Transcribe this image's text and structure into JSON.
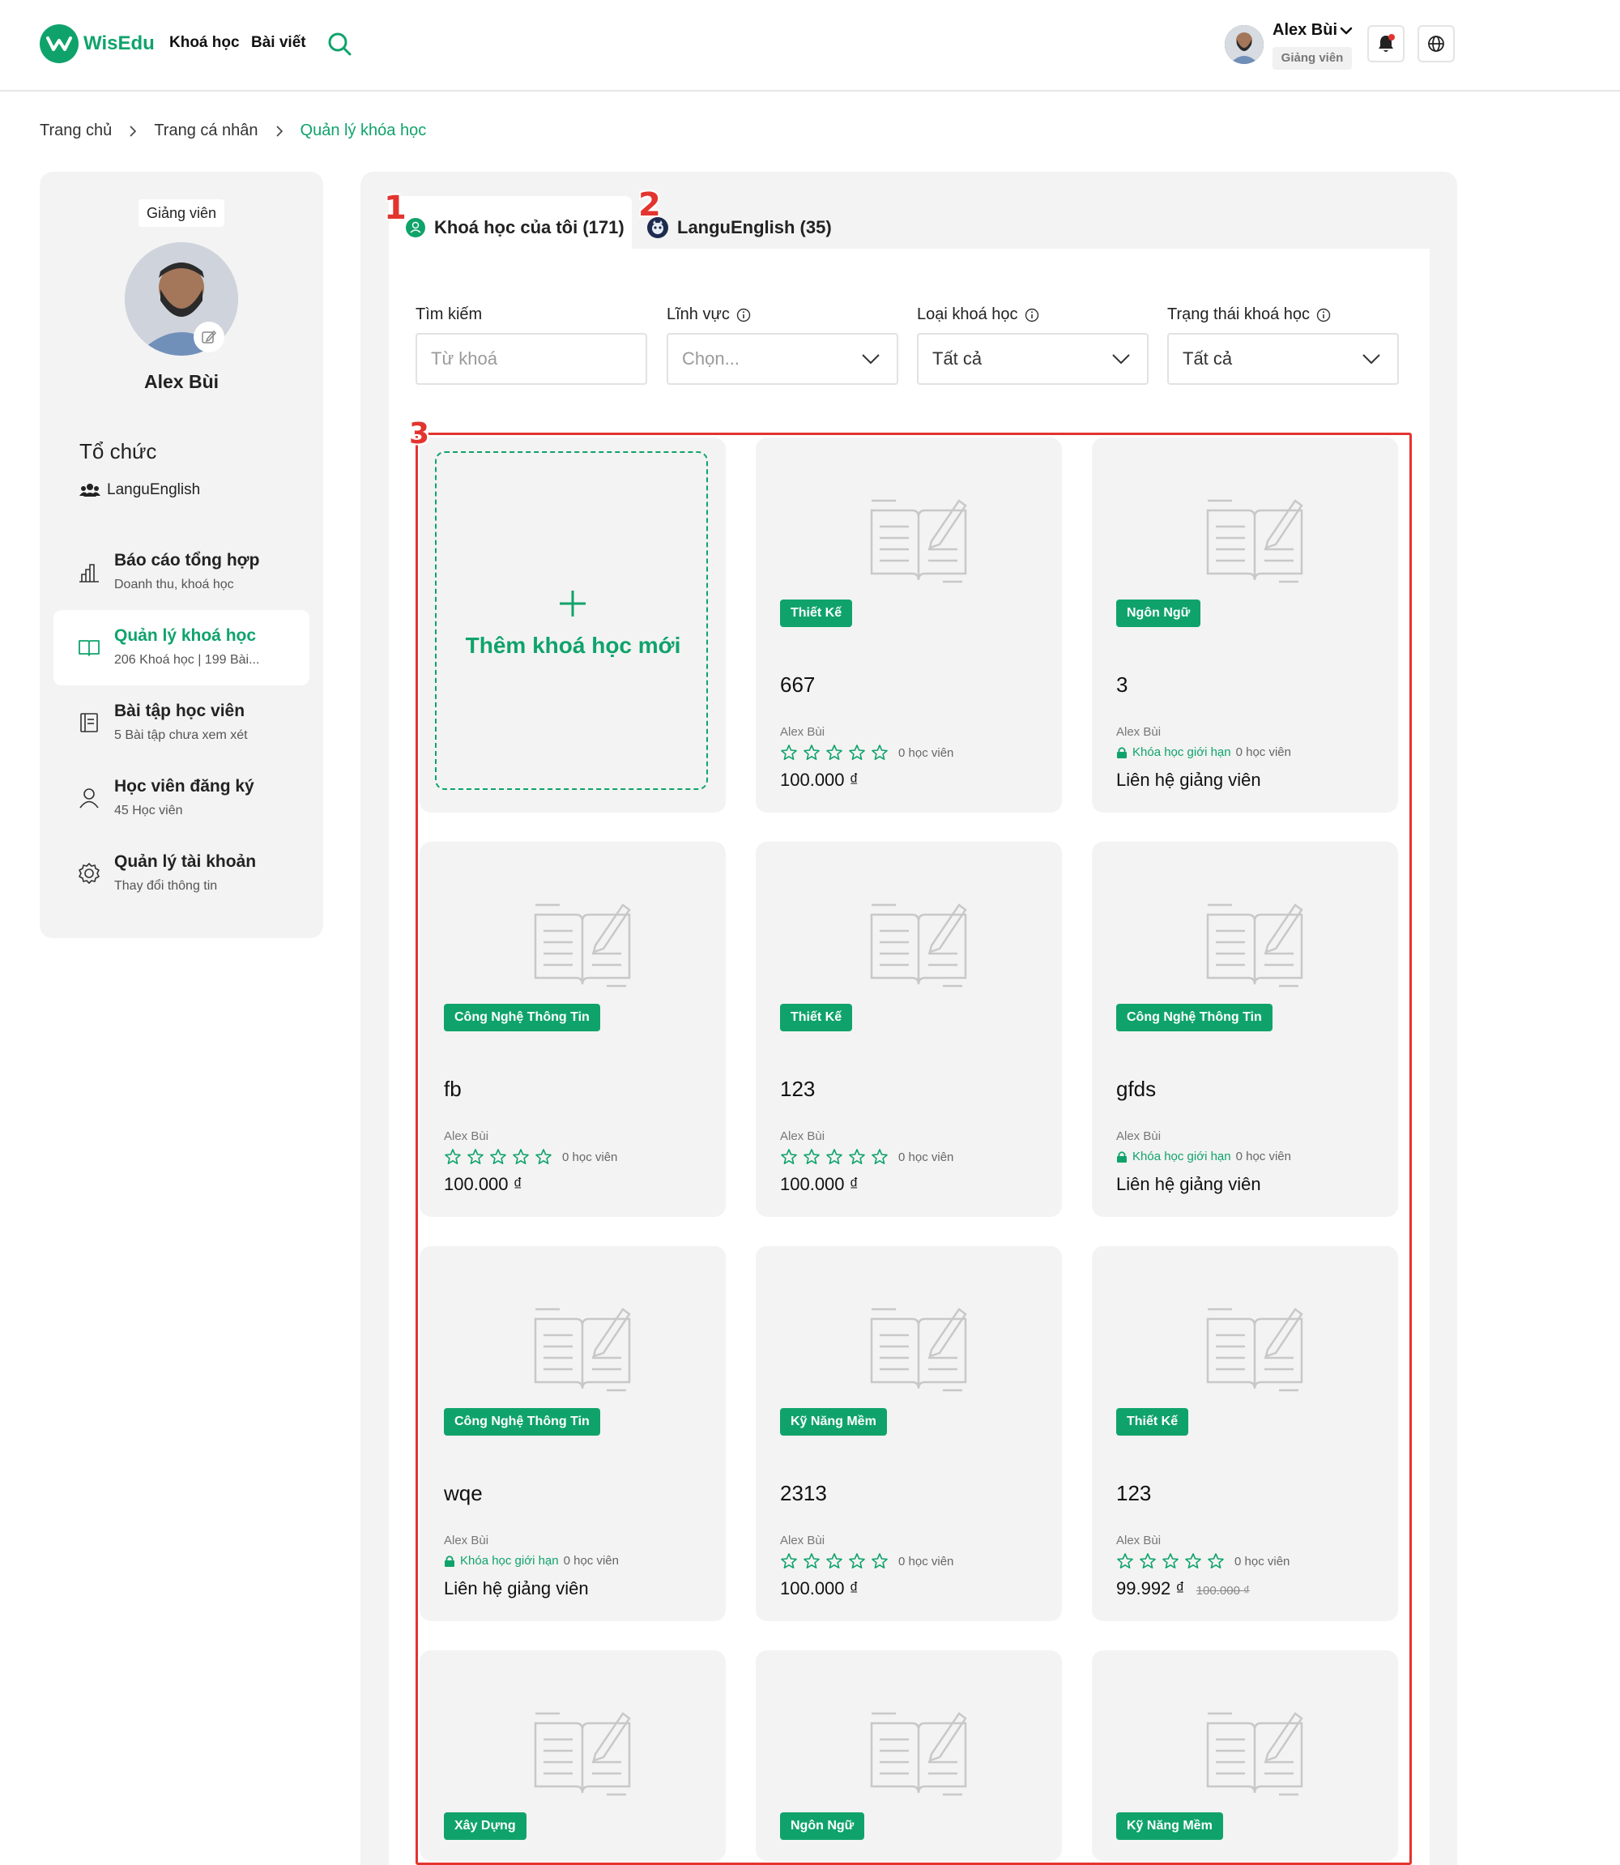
{
  "brand": {
    "name": "WisEdu",
    "color": "#0fa36b"
  },
  "header": {
    "nav": [
      {
        "label": "Khoá học"
      },
      {
        "label": "Bài viết"
      }
    ],
    "search_icon": "search-icon",
    "user": {
      "name": "Alex Bùi",
      "role": "Giảng viên"
    },
    "notification_icon": "bell-icon",
    "language_icon": "globe-icon"
  },
  "breadcrumb": [
    "Trang chủ",
    "Trang cá nhân",
    "Quản lý khóa học"
  ],
  "sidebar": {
    "role_tag": "Giảng viên",
    "name": "Alex Bùi",
    "org_heading": "Tổ chức",
    "org_name": "LanguEnglish",
    "menu": [
      {
        "title": "Báo cáo tổng hợp",
        "subtitle": "Doanh thu, khoá học",
        "icon": "bar-chart-icon"
      },
      {
        "title": "Quản lý khoá học",
        "subtitle": "206 Khoá học | 199 Bài...",
        "icon": "book-icon",
        "active": true
      },
      {
        "title": "Bài tập học viên",
        "subtitle": "5 Bài tập chưa xem xét",
        "icon": "document-icon"
      },
      {
        "title": "Học viên đăng ký",
        "subtitle": "45 Học viên",
        "icon": "user-icon"
      },
      {
        "title": "Quản lý tài khoản",
        "subtitle": "Thay đổi thông tin",
        "icon": "settings-icon"
      }
    ]
  },
  "tabs": [
    {
      "label": "Khoá học của tôi (171)",
      "badge": "1",
      "active": true
    },
    {
      "label": "LanguEnglish (35)",
      "badge": "2",
      "active": false
    }
  ],
  "grid_badge": "3",
  "filters": [
    {
      "label": "Tìm kiếm",
      "value": "Từ khoá",
      "placeholder": true,
      "info": false,
      "dropdown": false
    },
    {
      "label": "Lĩnh vực",
      "value": "Chọn...",
      "placeholder": true,
      "info": true,
      "dropdown": true
    },
    {
      "label": "Loại khoá học",
      "value": "Tất cả",
      "placeholder": false,
      "info": true,
      "dropdown": true
    },
    {
      "label": "Trạng thái khoá học",
      "value": "Tất cả",
      "placeholder": false,
      "info": true,
      "dropdown": true
    }
  ],
  "add_course_label": "Thêm khoá học mới",
  "courses": [
    {
      "category": "Thiết Kế",
      "title": "667",
      "author": "Alex Bùi",
      "type": "paid",
      "students": "0 học viên",
      "price": "100.000 ₫"
    },
    {
      "category": "Ngôn Ngữ",
      "title": "3",
      "author": "Alex Bùi",
      "type": "limited",
      "limited_label": "Khóa học giới hạn",
      "students": "0 học viên",
      "price": "Liên hệ giảng viên"
    },
    {
      "category": "Công Nghệ Thông Tin",
      "title": "fb",
      "author": "Alex Bùi",
      "type": "paid",
      "students": "0 học viên",
      "price": "100.000 ₫"
    },
    {
      "category": "Thiết Kế",
      "title": "123",
      "author": "Alex Bùi",
      "type": "paid",
      "students": "0 học viên",
      "price": "100.000 ₫"
    },
    {
      "category": "Công Nghệ Thông Tin",
      "title": "gfds",
      "author": "Alex Bùi",
      "type": "limited",
      "limited_label": "Khóa học giới hạn",
      "students": "0 học viên",
      "price": "Liên hệ giảng viên"
    },
    {
      "category": "Công Nghệ Thông Tin",
      "title": "wqe",
      "author": "Alex Bùi",
      "type": "limited",
      "limited_label": "Khóa học giới hạn",
      "students": "0 học viên",
      "price": "Liên hệ giảng viên"
    },
    {
      "category": "Kỹ Năng Mềm",
      "title": "2313",
      "author": "Alex Bùi",
      "type": "paid",
      "students": "0 học viên",
      "price": "100.000 ₫"
    },
    {
      "category": "Thiết Kế",
      "title": "123",
      "author": "Alex Bùi",
      "type": "paid",
      "students": "0 học viên",
      "price": "99.992 ₫",
      "old_price": "100.000 ₫"
    },
    {
      "category": "Xây Dựng",
      "title": "",
      "author": "",
      "type": "partial"
    },
    {
      "category": "Ngôn Ngữ",
      "title": "",
      "author": "",
      "type": "partial"
    },
    {
      "category": "Kỹ Năng Mềm",
      "title": "",
      "author": "",
      "type": "partial"
    }
  ]
}
